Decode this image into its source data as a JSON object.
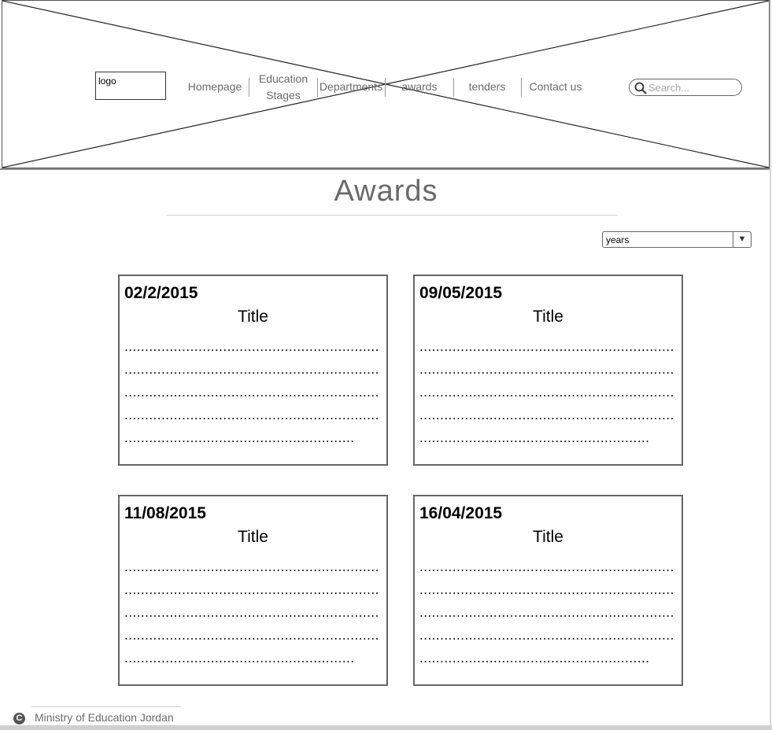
{
  "header": {
    "logo_text": "logo",
    "nav": [
      {
        "label": "Homepage"
      },
      {
        "label": "Education\nStages"
      },
      {
        "label": "Departments"
      },
      {
        "label": "awards"
      },
      {
        "label": "tenders"
      },
      {
        "label": "Contact us"
      }
    ],
    "search": {
      "placeholder": "Search..."
    }
  },
  "main": {
    "title": "Awards",
    "filter": {
      "selected": "years"
    },
    "cards": [
      {
        "date": "02/2/2015",
        "title": "Title"
      },
      {
        "date": "09/05/2015",
        "title": "Title"
      },
      {
        "date": "11/08/2015",
        "title": "Title"
      },
      {
        "date": "16/04/2015",
        "title": "Title"
      }
    ]
  },
  "footer": {
    "copyright_symbol": "C",
    "copyright_text": "Ministry of Education Jordan"
  }
}
